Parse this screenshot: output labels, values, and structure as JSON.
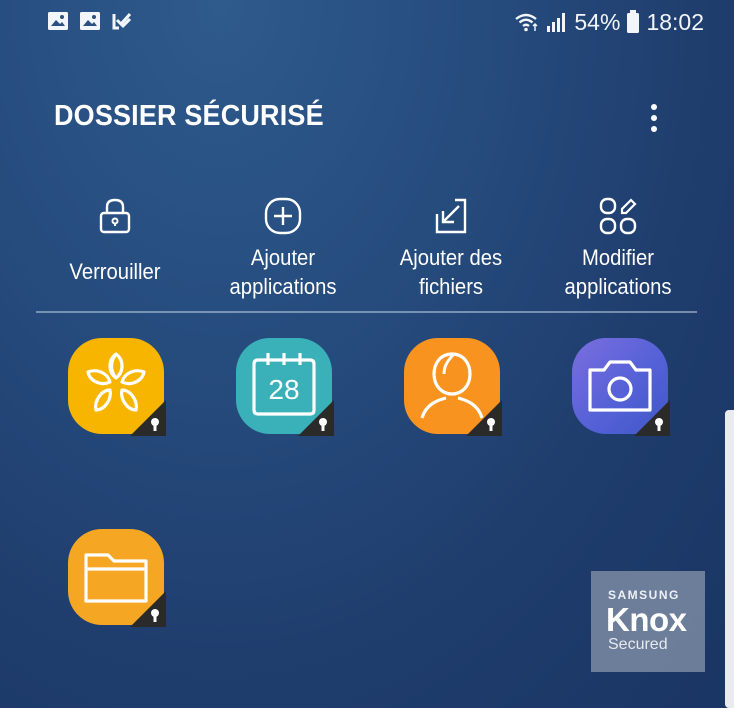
{
  "status_bar": {
    "left_icons": [
      "image-icon",
      "image-icon",
      "task-check-icon"
    ],
    "battery_percent": "54%",
    "time": "18:02",
    "right_icons": [
      "wifi-icon",
      "signal-icon",
      "battery-icon"
    ]
  },
  "header": {
    "title": "DOSSIER SÉCURISÉ",
    "menu_icon": "more-vertical-icon"
  },
  "actions": [
    {
      "label": "Verrouiller",
      "icon": "lock-icon"
    },
    {
      "label": "Ajouter applications",
      "line1": "Ajouter",
      "line2": "applications",
      "icon": "add-square-icon"
    },
    {
      "label": "Ajouter des fichiers",
      "line1": "Ajouter des",
      "line2": "fichiers",
      "icon": "import-file-icon"
    },
    {
      "label": "Modifier applications",
      "line1": "Modifier",
      "line2": "applications",
      "icon": "edit-apps-icon"
    }
  ],
  "apps": [
    {
      "name": "gallery-app",
      "icon": "gallery-flower-icon",
      "color": "#f7b500"
    },
    {
      "name": "calendar-app",
      "icon": "calendar-icon",
      "day": "28",
      "color": "#3ab0b8"
    },
    {
      "name": "contacts-app",
      "icon": "contact-person-icon",
      "color": "#f7931e"
    },
    {
      "name": "camera-app",
      "icon": "camera-icon",
      "color": "#5a63d8"
    },
    {
      "name": "my-files-app",
      "icon": "folder-icon",
      "color": "#f5a623"
    }
  ],
  "knox_badge": {
    "brand": "SAMSUNG",
    "product": "Knox",
    "status": "Secured"
  },
  "colors": {
    "background": "#244a7c",
    "lock_badge": "#2a2a2a"
  }
}
